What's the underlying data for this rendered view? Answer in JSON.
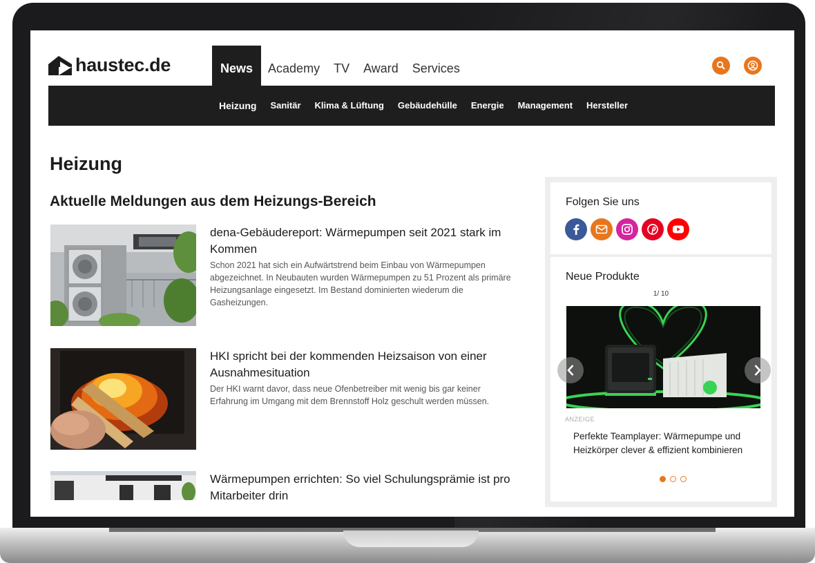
{
  "header": {
    "logo_text": "haustec.de",
    "main_nav": [
      "News",
      "Academy",
      "TV",
      "Award",
      "Services"
    ],
    "search_icon": "search-icon",
    "account_icon": "user-icon",
    "accent": "#e8761c"
  },
  "subnav": [
    "Heizung",
    "Sanitär",
    "Klima & Lüftung",
    "Gebäudehülle",
    "Energie",
    "Management",
    "Hersteller"
  ],
  "page": {
    "title": "Heizung",
    "section_title": "Aktuelle Meldungen aus dem Heizungs-Bereich"
  },
  "articles": [
    {
      "headline": "dena-Gebäudereport: Wärmepumpen seit 2021 stark im Kommen",
      "teaser": "Schon 2021 hat sich ein Aufwärtstrend beim Einbau von Wärmepumpen abgezeichnet. In Neubauten wurden Wärmepumpen zu 51 Prozent als primäre Heizungsanlage eingesetzt. Im Bestand dominierten wiederum die Gasheizungen."
    },
    {
      "headline": "HKI spricht bei der kommenden Heizsaison von einer Ausnahmesituation",
      "teaser": "Der HKI warnt davor, dass neue Ofenbetreiber mit wenig bis gar keiner Erfahrung im Umgang mit dem Brennstoff Holz geschult werden müssen."
    },
    {
      "headline": "Wärmepumpen errichten: So viel Schulungsprämie ist pro Mitarbeiter drin",
      "teaser": ""
    }
  ],
  "sidebar": {
    "follow_title": "Folgen Sie uns",
    "social": [
      {
        "icon": "facebook-icon",
        "color": "#3b5998"
      },
      {
        "icon": "mail-icon",
        "color": "#e8761c"
      },
      {
        "icon": "instagram-icon",
        "color": "#d6249f"
      },
      {
        "icon": "pinterest-icon",
        "color": "#e60023"
      },
      {
        "icon": "youtube-icon",
        "color": "#ff0000"
      }
    ],
    "products_title": "Neue Produkte",
    "counter": "1/ 10",
    "ad_label": "ANZEIGE",
    "product_title": "Perfekte Teamplayer: Wärmepumpe und Heizkörper clever & effizient kombinieren",
    "slide_indicator": {
      "current": 1,
      "total": 3
    }
  }
}
